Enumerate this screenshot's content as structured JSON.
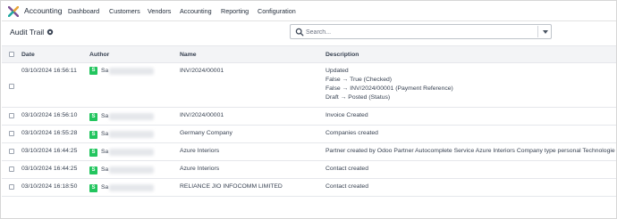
{
  "navbar": {
    "app_name": "Accounting",
    "menus": [
      "Dashboard",
      "Customers",
      "Vendors",
      "Accounting",
      "Reporting",
      "Configuration"
    ]
  },
  "control": {
    "title": "Audit Trail",
    "search_placeholder": "Search..."
  },
  "table": {
    "columns": [
      "Date",
      "Author",
      "Name",
      "Description"
    ],
    "rows": [
      {
        "date": "03/10/2024 16:56:11",
        "author_initial": "S",
        "author_prefix": "Sa",
        "name": "INV/2024/00001",
        "description": [
          "Updated",
          "False → True (Checked)",
          "False → INV/2024/00001 (Payment Reference)",
          "Draft → Posted (Status)"
        ]
      },
      {
        "date": "03/10/2024 16:56:10",
        "author_initial": "S",
        "author_prefix": "Sa",
        "name": "INV/2024/00001",
        "description": [
          "Invoice Created"
        ]
      },
      {
        "date": "03/10/2024 16:55:28",
        "author_initial": "S",
        "author_prefix": "Sa",
        "name": "Germany Company",
        "description": [
          "Companies created"
        ]
      },
      {
        "date": "03/10/2024 16:44:25",
        "author_initial": "S",
        "author_prefix": "Sa",
        "name": "Azure Interiors",
        "description": [
          "Partner created by Odoo Partner Autocomplete Service Azure Interiors Company type personal Technologie"
        ]
      },
      {
        "date": "03/10/2024 16:44:25",
        "author_initial": "S",
        "author_prefix": "Sa",
        "name": "Azure Interiors",
        "description": [
          "Contact created"
        ]
      },
      {
        "date": "03/10/2024 16:18:50",
        "author_initial": "S",
        "author_prefix": "Sa",
        "name": "RELIANCE JIO INFOCOMM LIMITED",
        "description": [
          "Contact created"
        ]
      }
    ]
  },
  "icons": {
    "app_logo": "accounting-logo-icon",
    "gear": "gear-icon",
    "search": "search-icon",
    "dropdown": "caret-down-icon"
  },
  "colors": {
    "avatar": "#22c55e",
    "header_bg": "#f3f4f6"
  }
}
